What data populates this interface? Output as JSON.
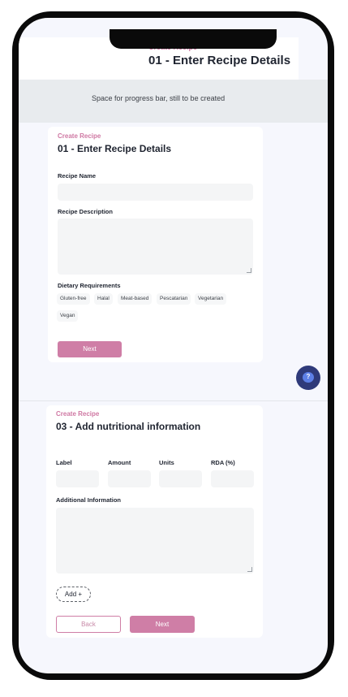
{
  "top_header": {
    "eyebrow": "Create Recipe",
    "title": "01 - Enter Recipe Details"
  },
  "progress_placeholder": "Space for progress bar, still to be created",
  "step1": {
    "eyebrow": "Create Recipe",
    "title": "01 - Enter Recipe Details",
    "recipe_name_label": "Recipe Name",
    "recipe_name_value": "",
    "recipe_description_label": "Recipe Description",
    "recipe_description_value": "",
    "dietary_label": "Dietary Requirements",
    "dietary_options": [
      "Gluten-free",
      "Halal",
      "Meat-based",
      "Pescatarian",
      "Vegetarian",
      "Vegan"
    ],
    "next_label": "Next"
  },
  "step3": {
    "eyebrow": "Create Recipe",
    "title": "03 - Add nutritional information",
    "columns": [
      "Label",
      "Amount",
      "Units",
      "RDA (%)"
    ],
    "additional_label": "Additional Information",
    "add_label": "Add +",
    "back_label": "Back",
    "next_label": "Next"
  },
  "help_button": {
    "icon": "question-chat-icon",
    "glyph": "?"
  },
  "colors": {
    "accent": "#cf7ea6",
    "heading": "#1f2430",
    "fab": "#2f3a7a",
    "field": "#f4f5f6"
  }
}
